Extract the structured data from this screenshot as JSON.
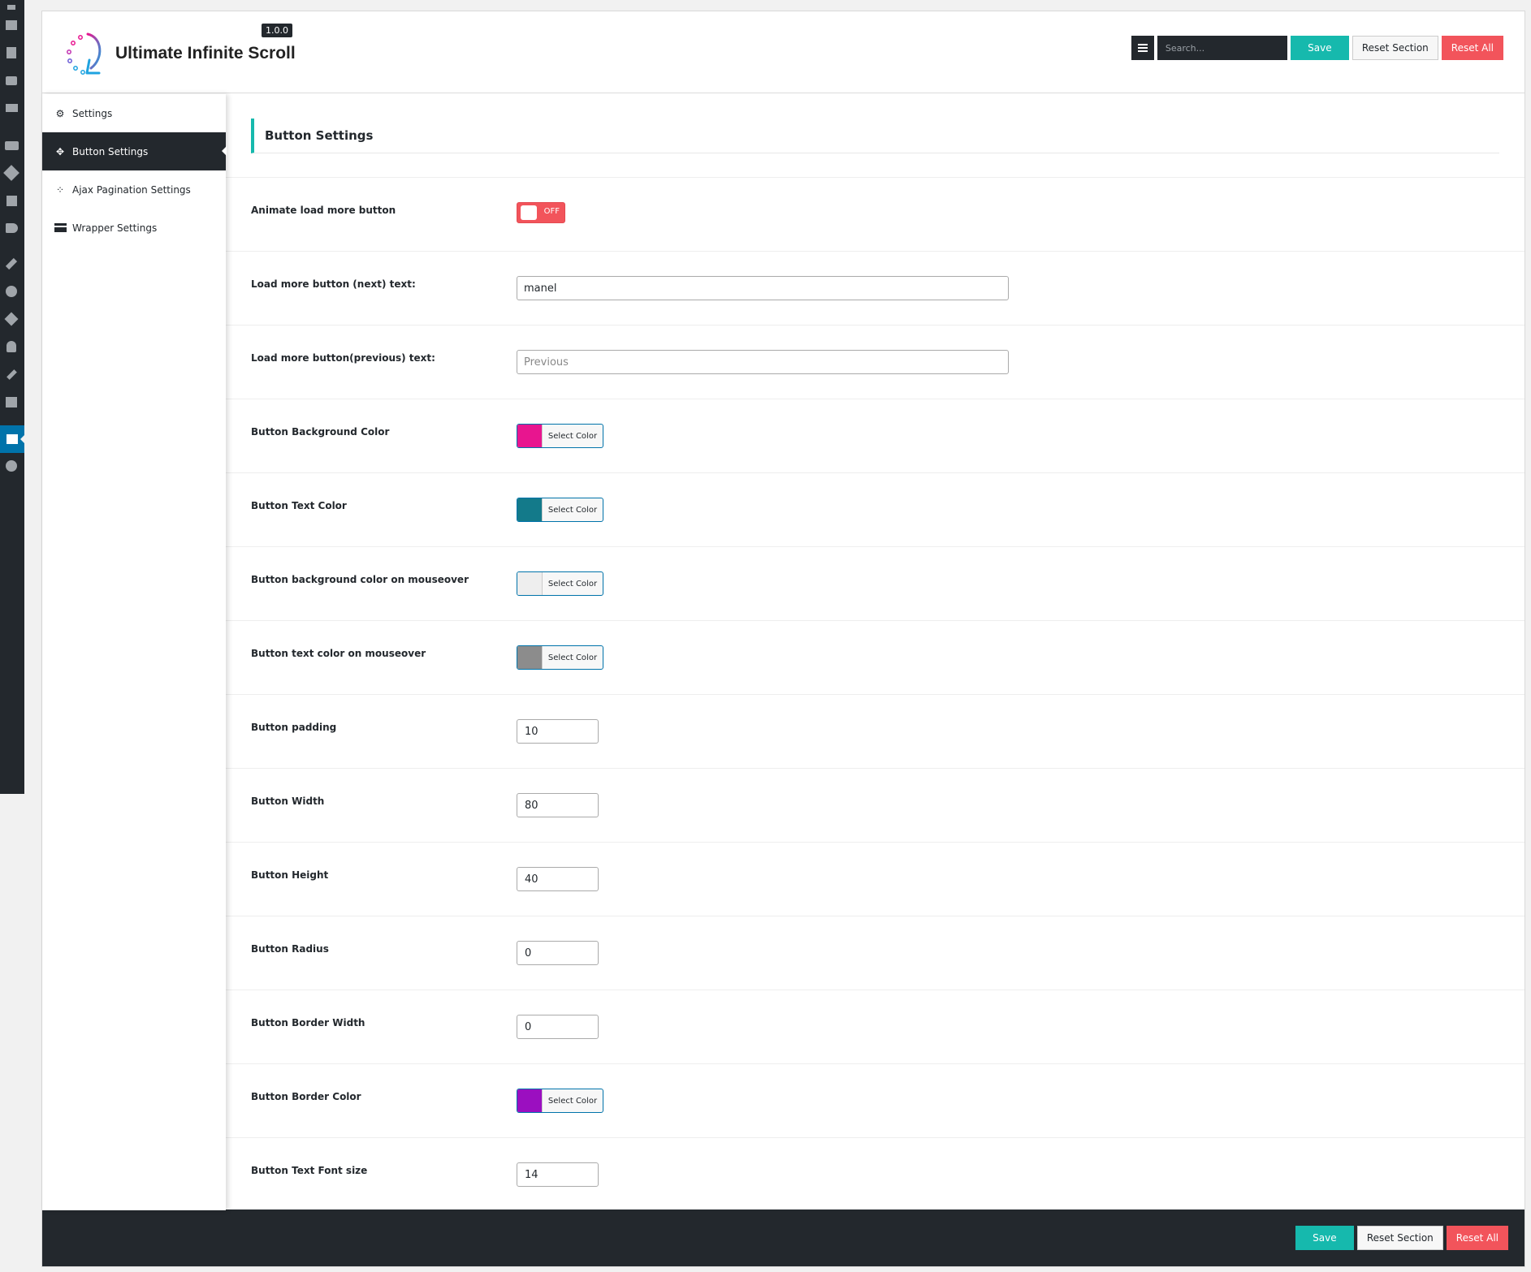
{
  "header": {
    "title": "Ultimate Infinite Scroll",
    "version": "1.0.0",
    "search_placeholder": "Search...",
    "save_label": "Save",
    "reset_section_label": "Reset Section",
    "reset_all_label": "Reset All"
  },
  "sidebar": {
    "items": [
      {
        "label": "Settings",
        "icon": "gears-icon"
      },
      {
        "label": "Button Settings",
        "icon": "arrows-move-icon",
        "active": true
      },
      {
        "label": "Ajax Pagination Settings",
        "icon": "spinner-icon"
      },
      {
        "label": "Wrapper Settings",
        "icon": "credit-card-icon"
      }
    ]
  },
  "section": {
    "title": "Button Settings",
    "fields": {
      "animate": {
        "label": "Animate load more button",
        "toggle_text": "OFF",
        "on": false
      },
      "next_text": {
        "label": "Load more button (next) text:",
        "value": "manel"
      },
      "prev_text": {
        "label": "Load more button(previous) text:",
        "placeholder": "Previous"
      },
      "bg_color": {
        "label": "Button Background Color",
        "color": "#e8158f",
        "button": "Select Color"
      },
      "text_color": {
        "label": "Button Text Color",
        "color": "#137a8a",
        "button": "Select Color"
      },
      "bg_hover": {
        "label": "Button background color on mouseover",
        "color": "#eeeeee",
        "button": "Select Color"
      },
      "text_hover": {
        "label": "Button text color on mouseover",
        "color": "#8c8c8c",
        "button": "Select Color"
      },
      "padding": {
        "label": "Button padding",
        "value": "10"
      },
      "width": {
        "label": "Button Width",
        "value": "80"
      },
      "height": {
        "label": "Button Height",
        "value": "40"
      },
      "radius": {
        "label": "Button Radius",
        "value": "0"
      },
      "border_width": {
        "label": "Button Border Width",
        "value": "0"
      },
      "border_color": {
        "label": "Button Border Color",
        "color": "#9b0fc0",
        "button": "Select Color"
      },
      "font_size": {
        "label": "Button Text Font size",
        "value": "14"
      }
    }
  },
  "footer": {
    "save_label": "Save",
    "reset_section_label": "Reset Section",
    "reset_all_label": "Reset All"
  },
  "colors": {
    "accent": "#16b9ad",
    "danger": "#f2545b",
    "dark": "#23282d",
    "wp_active": "#0073aa"
  }
}
